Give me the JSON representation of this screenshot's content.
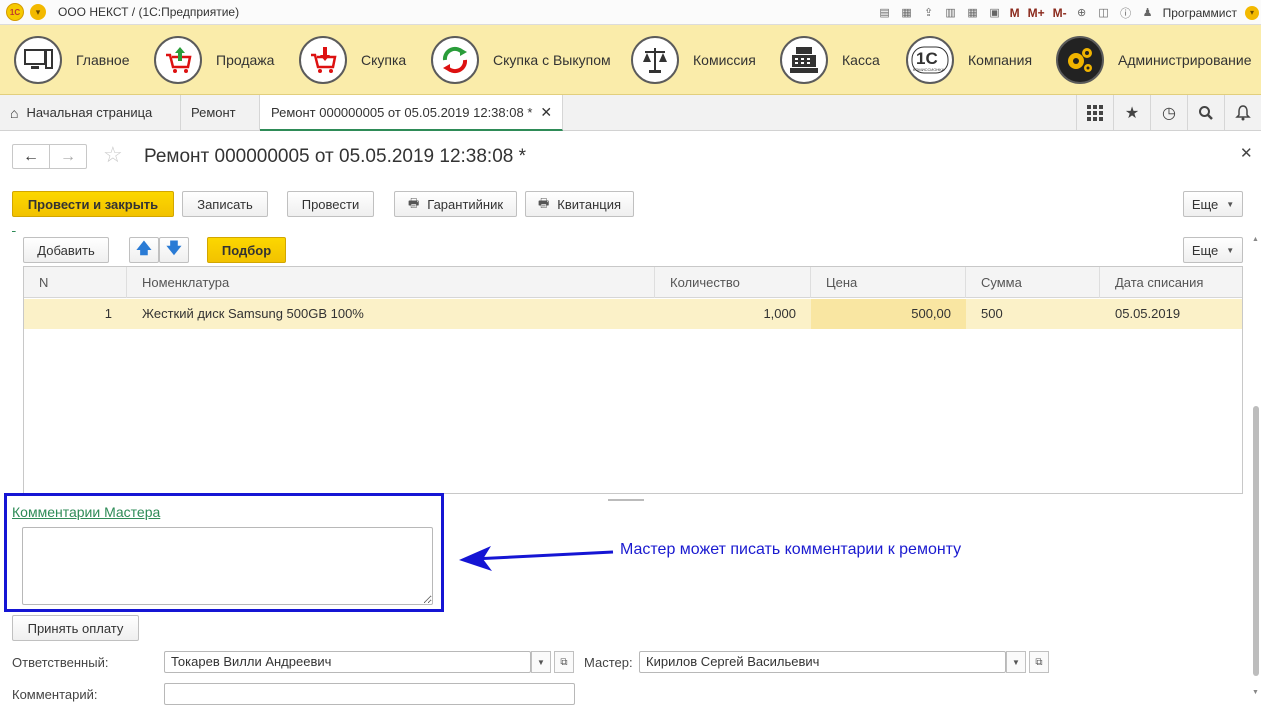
{
  "titlebar": {
    "title": "ООО НЕКСТ /  (1С:Предприятие)",
    "user": "Программист",
    "m_labels": [
      "M",
      "M+",
      "M-"
    ]
  },
  "sections": [
    {
      "label": "Главное",
      "icon": "computer-icon"
    },
    {
      "label": "Продажа",
      "icon": "cart-up-icon"
    },
    {
      "label": "Скупка",
      "icon": "cart-down-icon"
    },
    {
      "label": "Скупка с Выкупом",
      "icon": "cycle-icon"
    },
    {
      "label": "Комиссия",
      "icon": "scales-icon"
    },
    {
      "label": "Касса",
      "icon": "cash-register-icon"
    },
    {
      "label": "Компания",
      "icon": "1c-commission-icon"
    },
    {
      "label": "Администрирование",
      "icon": "gears-icon"
    }
  ],
  "tabs": {
    "home": "Начальная страница",
    "repair": "Ремонт",
    "active": "Ремонт 000000005 от 05.05.2019 12:38:08 *"
  },
  "form": {
    "title": "Ремонт 000000005 от 05.05.2019 12:38:08 *",
    "buttons": {
      "post_close": "Провести и закрыть",
      "save": "Записать",
      "post": "Провести",
      "warranty": "Гарантийник",
      "receipt": "Квитанция",
      "more": "Еще"
    }
  },
  "table_toolbar": {
    "add": "Добавить",
    "pick": "Подбор",
    "more": "Еще"
  },
  "table": {
    "columns": [
      "N",
      "Номенклатура",
      "Количество",
      "Цена",
      "Сумма",
      "Дата списания"
    ],
    "rows": [
      {
        "n": "1",
        "item": "Жесткий диск Samsung 500GB 100%",
        "qty": "1,000",
        "price": "500,00",
        "sum": "500",
        "date": "05.05.2019"
      }
    ]
  },
  "comments": {
    "master_link": "Комментарии Мастера",
    "master_text": ""
  },
  "annotation": {
    "text": "Мастер может писать комментарии к ремонту",
    "color": "#1a1ad0"
  },
  "payment_button": "Принять оплату",
  "fields": {
    "responsible_label": "Ответственный:",
    "responsible_value": "Токарев Вилли Андреевич",
    "master_label": "Мастер:",
    "master_value": "Кирилов Сергей Васильевич",
    "comment_label": "Комментарий:",
    "comment_value": ""
  },
  "colors": {
    "accent_yellow": "#f2c200",
    "section_bg": "#faecaa",
    "link_green": "#2e8b57",
    "highlight_blue": "#1515d4"
  }
}
